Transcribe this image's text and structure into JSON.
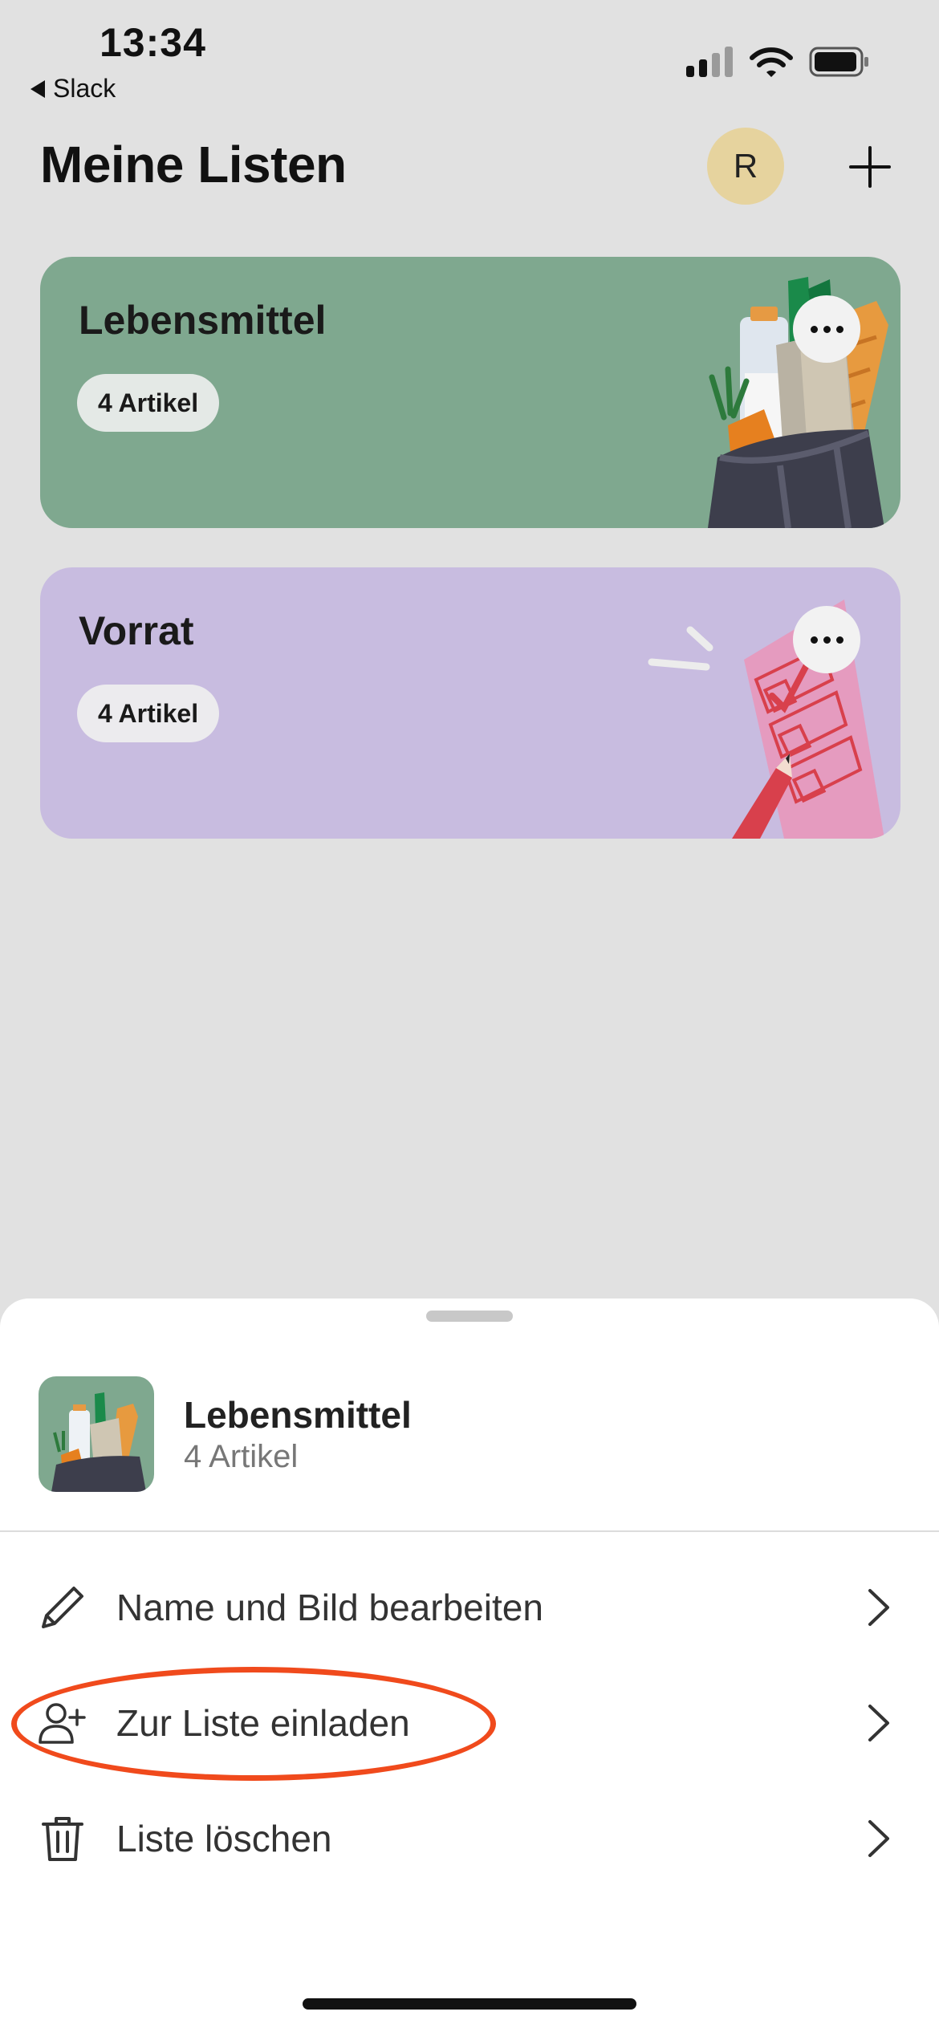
{
  "status_bar": {
    "time": "13:34",
    "back_app": "Slack",
    "icons": [
      "signal-icon",
      "wifi-icon",
      "battery-icon"
    ]
  },
  "header": {
    "title": "Meine Listen",
    "avatar_initial": "R",
    "add_icon": "plus-icon"
  },
  "lists": [
    {
      "title": "Lebensmittel",
      "count": "4 Artikel",
      "color": "#7fa88f",
      "illustration": "grocery-bag-illustration"
    },
    {
      "title": "Vorrat",
      "count": "4 Artikel",
      "color": "#c8bce0",
      "illustration": "checklist-illustration"
    }
  ],
  "sheet": {
    "list_title": "Lebensmittel",
    "list_count": "4 Artikel",
    "menu": [
      {
        "label": "Name und Bild bearbeiten",
        "icon": "pencil-icon"
      },
      {
        "label": "Zur Liste einladen",
        "icon": "add-person-icon",
        "highlighted": true
      },
      {
        "label": "Liste löschen",
        "icon": "trash-icon"
      }
    ]
  },
  "colors": {
    "background": "#e1e1e1",
    "highlight": "#f04a1c",
    "avatar": "#e6d39e"
  }
}
